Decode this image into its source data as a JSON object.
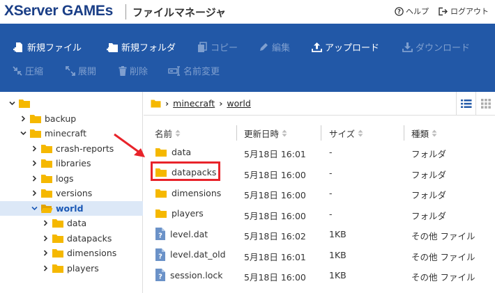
{
  "header": {
    "logo": "XServer GAMEs",
    "title": "ファイルマネージャ",
    "help_label": "ヘルプ",
    "logout_label": "ログアウト"
  },
  "toolbar": {
    "row1": [
      {
        "label": "新規ファイル",
        "enabled": true,
        "icon": "new-file-icon"
      },
      {
        "label": "新規フォルダ",
        "enabled": true,
        "icon": "new-folder-icon"
      },
      {
        "label": "コピー",
        "enabled": false,
        "icon": "copy-icon"
      },
      {
        "label": "編集",
        "enabled": false,
        "icon": "edit-icon"
      },
      {
        "label": "アップロード",
        "enabled": true,
        "icon": "upload-icon"
      },
      {
        "label": "ダウンロード",
        "enabled": false,
        "icon": "download-icon"
      }
    ],
    "row2": [
      {
        "label": "圧縮",
        "enabled": false,
        "icon": "compress-icon"
      },
      {
        "label": "展開",
        "enabled": false,
        "icon": "expand-icon"
      },
      {
        "label": "削除",
        "enabled": false,
        "icon": "trash-icon"
      },
      {
        "label": "名前変更",
        "enabled": false,
        "icon": "rename-icon"
      }
    ]
  },
  "tree": [
    {
      "label": "",
      "level": 0,
      "expanded": true,
      "selected": false
    },
    {
      "label": "backup",
      "level": 1,
      "expanded": false,
      "selected": false
    },
    {
      "label": "minecraft",
      "level": 1,
      "expanded": true,
      "selected": false
    },
    {
      "label": "crash-reports",
      "level": 2,
      "expanded": false,
      "selected": false
    },
    {
      "label": "libraries",
      "level": 2,
      "expanded": false,
      "selected": false
    },
    {
      "label": "logs",
      "level": 2,
      "expanded": false,
      "selected": false
    },
    {
      "label": "versions",
      "level": 2,
      "expanded": false,
      "selected": false
    },
    {
      "label": "world",
      "level": 2,
      "expanded": true,
      "selected": true
    },
    {
      "label": "data",
      "level": 3,
      "expanded": false,
      "selected": false
    },
    {
      "label": "datapacks",
      "level": 3,
      "expanded": false,
      "selected": false
    },
    {
      "label": "dimensions",
      "level": 3,
      "expanded": false,
      "selected": false
    },
    {
      "label": "players",
      "level": 3,
      "expanded": false,
      "selected": false
    }
  ],
  "breadcrumb": [
    "minecraft",
    "world"
  ],
  "columns": {
    "name": "名前",
    "modified": "更新日時",
    "size": "サイズ",
    "type": "種類"
  },
  "files": [
    {
      "name": "data",
      "modified": "5月18日 16:01",
      "size": "-",
      "type": "フォルダ",
      "kind": "folder"
    },
    {
      "name": "datapacks",
      "modified": "5月18日 16:00",
      "size": "-",
      "type": "フォルダ",
      "kind": "folder"
    },
    {
      "name": "dimensions",
      "modified": "5月18日 16:00",
      "size": "-",
      "type": "フォルダ",
      "kind": "folder"
    },
    {
      "name": "players",
      "modified": "5月18日 16:00",
      "size": "-",
      "type": "フォルダ",
      "kind": "folder"
    },
    {
      "name": "level.dat",
      "modified": "5月18日 16:02",
      "size": "1KB",
      "type": "その他 ファイル",
      "kind": "file"
    },
    {
      "name": "level.dat_old",
      "modified": "5月18日 16:01",
      "size": "1KB",
      "type": "その他 ファイル",
      "kind": "file"
    },
    {
      "name": "session.lock",
      "modified": "5月18日 16:00",
      "size": "1KB",
      "type": "その他 ファイル",
      "kind": "file"
    }
  ],
  "colors": {
    "toolbar_bg": "#2258a7",
    "folder": "#f5b800",
    "highlight": "#e8232a",
    "selected_row": "#dce8f7"
  }
}
